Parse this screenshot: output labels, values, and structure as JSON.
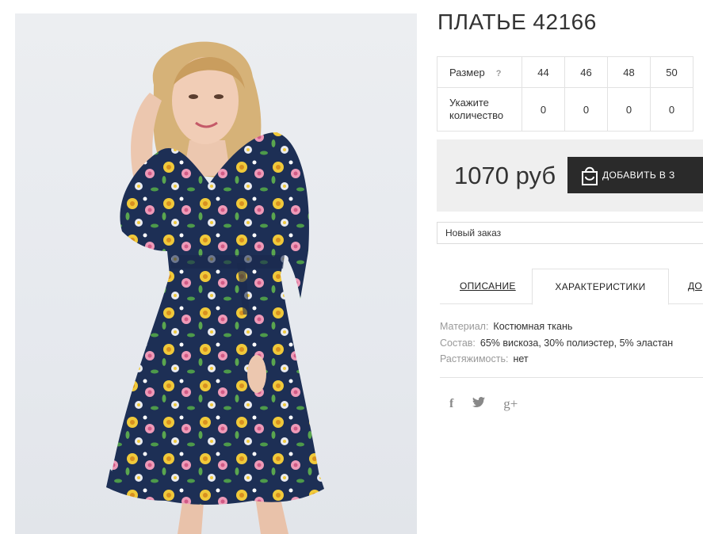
{
  "product": {
    "title": "ПЛАТЬЕ 42166",
    "image_alt": "floral-print navy dress photo"
  },
  "sizes": {
    "size_label": "Размер",
    "help": "?",
    "values": [
      "44",
      "46",
      "48",
      "50"
    ],
    "qty_label_line1": "Укажите",
    "qty_label_line2": "количество",
    "quantities": [
      "0",
      "0",
      "0",
      "0"
    ]
  },
  "purchase": {
    "price": "1070 руб",
    "cart_button": "ДОБАВИТЬ В З",
    "order_select": "Новый заказ"
  },
  "tabs": {
    "description": "ОПИСАНИЕ",
    "characteristics": "ХАРАКТЕРИСТИКИ",
    "delivery": "ДО"
  },
  "characteristics": [
    {
      "key": "Материал:",
      "value": "Костюмная ткань"
    },
    {
      "key": "Состав:",
      "value": "65% вискоза, 30% полиэстер, 5% эластан"
    },
    {
      "key": "Растяжимость:",
      "value": "нет"
    }
  ],
  "social": {
    "facebook_glyph": "f",
    "gplus_glyph": "g+"
  },
  "colors": {
    "button_bg": "#2a2a2a",
    "price_bg": "#efefef",
    "dress_navy": "#1d2f55"
  }
}
